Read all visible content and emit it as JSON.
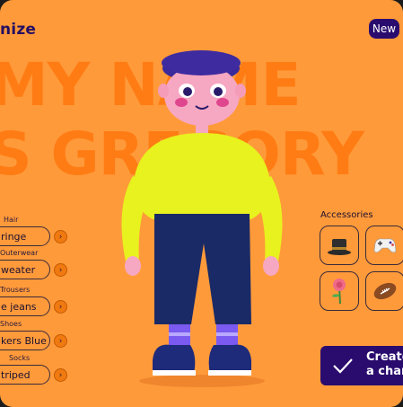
{
  "app": {
    "brand": "nize"
  },
  "header": {
    "new_label": "New"
  },
  "background_name": {
    "line1": "MY NAME",
    "line2": "S GREGORY"
  },
  "options": [
    {
      "label": "Hair",
      "value": "ringe"
    },
    {
      "label": "Outerwear",
      "value": "weater"
    },
    {
      "label": "Trousers",
      "value": "e jeans"
    },
    {
      "label": "Shoes",
      "value": "kers Blue"
    },
    {
      "label": "Socks",
      "value": "triped"
    }
  ],
  "accessories": {
    "title": "Accessories",
    "items": [
      "top-hat",
      "game-controller",
      "rose",
      "football"
    ]
  },
  "cta": {
    "label": "Create\na char"
  },
  "colors": {
    "background": "#FF9A3A",
    "accent": "#2A0C6E",
    "sweater": "#E8F21E",
    "pants": "#1A2A66"
  }
}
